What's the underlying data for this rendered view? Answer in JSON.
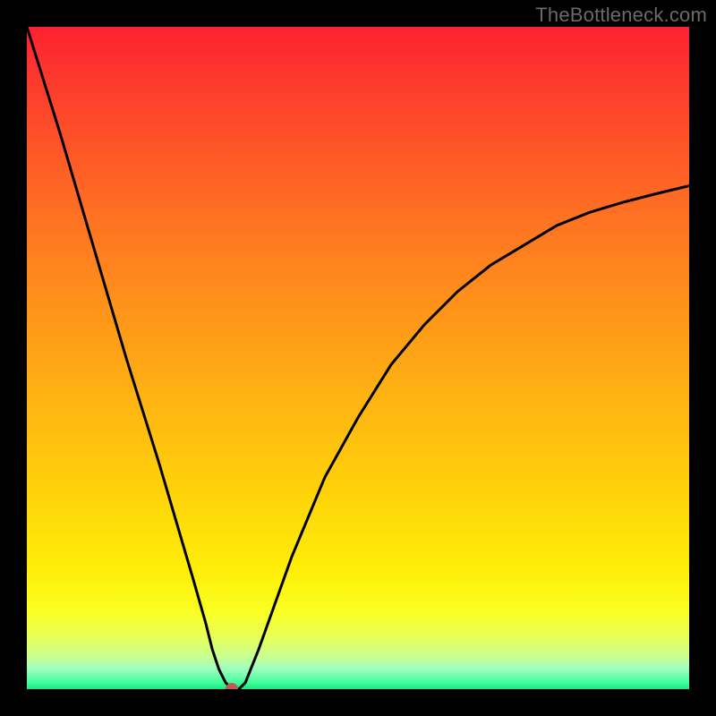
{
  "watermark": "TheBottleneck.com",
  "colors": {
    "frame_bg": "#000000",
    "dot": "#c05a52",
    "curve": "#000000",
    "gradient_top": "#fc2230",
    "gradient_bottom": "#18e880"
  },
  "chart_data": {
    "type": "line",
    "title": "",
    "xlabel": "",
    "ylabel": "",
    "xlim": [
      0,
      100
    ],
    "ylim": [
      0,
      100
    ],
    "grid": false,
    "legend": false,
    "x": [
      0,
      5,
      10,
      15,
      20,
      25,
      27,
      28,
      29,
      30,
      31,
      32,
      33,
      35,
      40,
      45,
      50,
      55,
      60,
      65,
      70,
      75,
      80,
      85,
      90,
      95,
      100
    ],
    "values": [
      100,
      84,
      67,
      50,
      34,
      17,
      10,
      6,
      3,
      1,
      0,
      0,
      1,
      6,
      20,
      32,
      41,
      49,
      55,
      60,
      64,
      67,
      70,
      72,
      73.5,
      74.8,
      76
    ],
    "minimum_marker": {
      "x": 31,
      "y": 0
    }
  }
}
